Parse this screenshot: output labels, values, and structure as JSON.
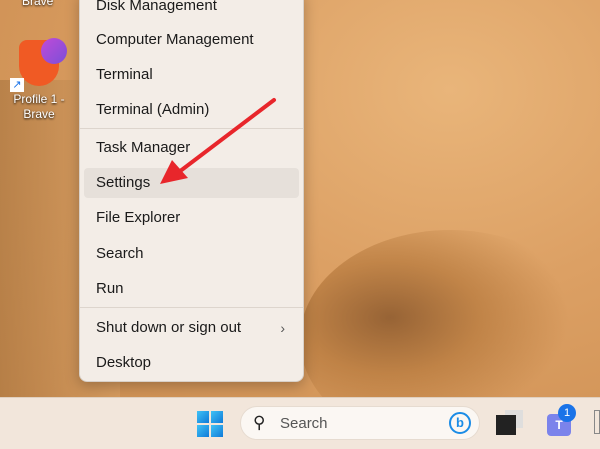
{
  "desktop": {
    "shortcut_label": "Profile 1 - Brave",
    "top_label": "Brave"
  },
  "menu": {
    "items": [
      {
        "label": "Disk Management"
      },
      {
        "label": "Computer Management"
      },
      {
        "label": "Terminal"
      },
      {
        "label": "Terminal (Admin)"
      },
      {
        "label": "Task Manager"
      },
      {
        "label": "Settings"
      },
      {
        "label": "File Explorer"
      },
      {
        "label": "Search"
      },
      {
        "label": "Run"
      },
      {
        "label": "Shut down or sign out"
      },
      {
        "label": "Desktop"
      }
    ],
    "submenu_chevron": "›"
  },
  "taskbar": {
    "search_placeholder": "Search",
    "teams_badge": "1",
    "search_glyph": "⚲",
    "bing_glyph": "b",
    "teams_glyph": "T"
  },
  "colors": {
    "annotation_arrow": "#e8262b"
  }
}
